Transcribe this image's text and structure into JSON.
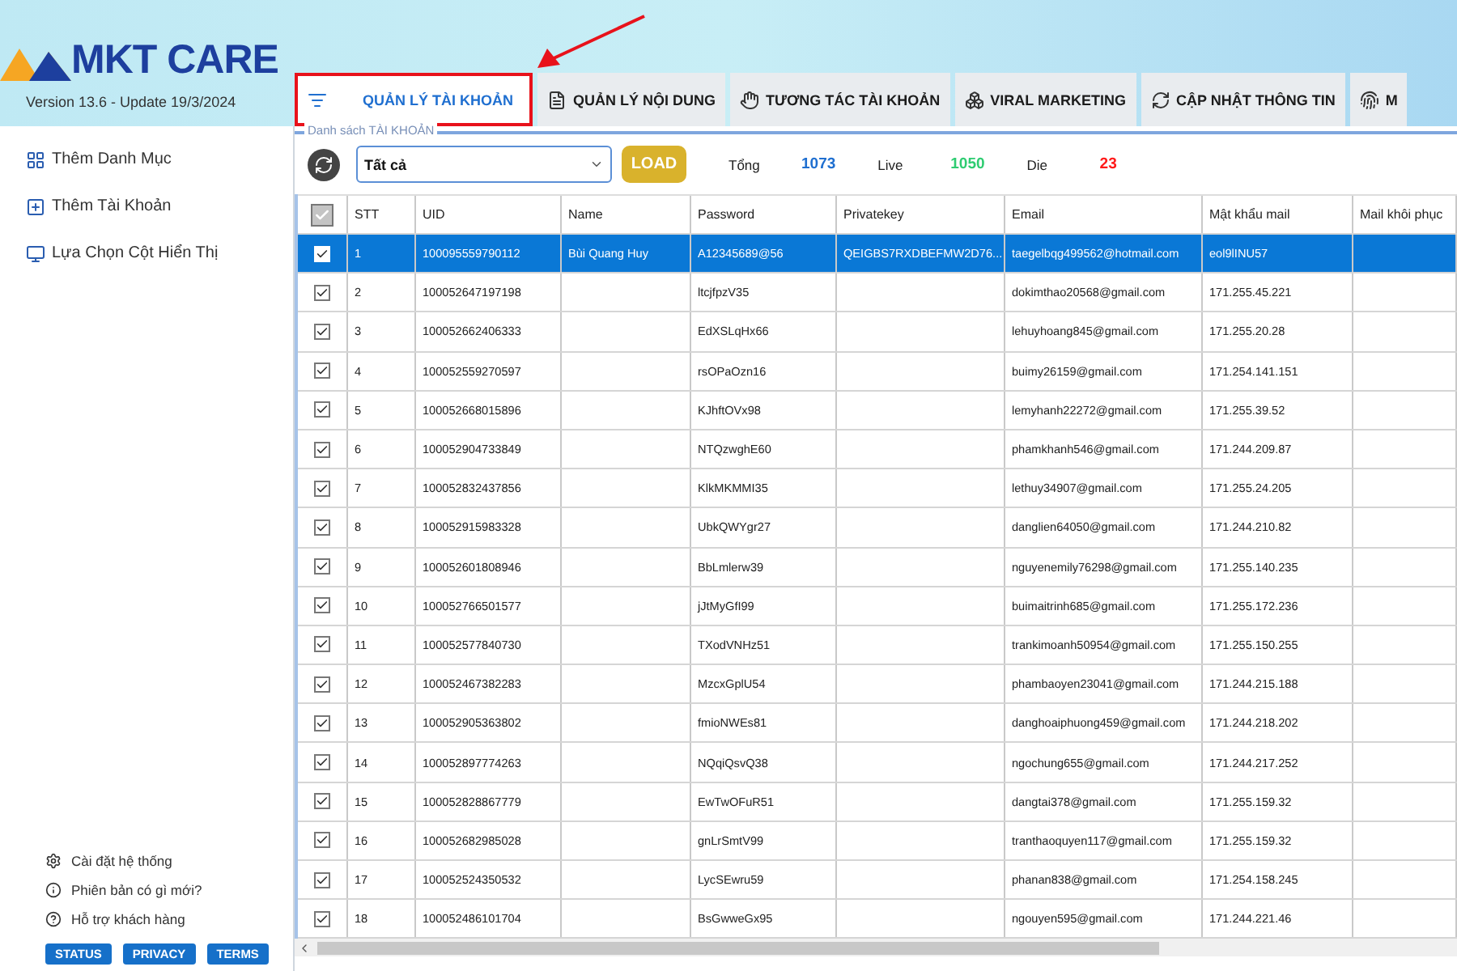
{
  "app": {
    "logo": "MKT CARE",
    "version": "Version  13.6 - Update  19/3/2024"
  },
  "tabs": [
    {
      "label": "QUẢN LÝ TÀI KHOẢN",
      "selected": true,
      "kind": "accounts"
    },
    {
      "label": "QUẢN LÝ NỘI DUNG",
      "selected": false,
      "kind": "content"
    },
    {
      "label": "TƯƠNG TÁC TÀI KHOẢN",
      "selected": false,
      "kind": "interact"
    },
    {
      "label": "VIRAL MARKETING",
      "selected": false,
      "kind": "viral"
    },
    {
      "label": "CẬP NHẬT THÔNG TIN",
      "selected": false,
      "kind": "update"
    },
    {
      "label": "M",
      "selected": false,
      "kind": "fingerprint"
    }
  ],
  "sidebar": {
    "items": [
      {
        "label": "Thêm Danh Mục",
        "kind": "category"
      },
      {
        "label": "Thêm Tài Khoản",
        "kind": "account"
      },
      {
        "label": "Lựa Chọn Cột Hiển Thị",
        "kind": "columns"
      }
    ],
    "footer_items": [
      {
        "label": "Cài đặt hệ thống",
        "kind": "settings"
      },
      {
        "label": "Phiên bản có gì mới?",
        "kind": "info"
      },
      {
        "label": "Hỗ trợ khách hàng",
        "kind": "help"
      }
    ],
    "buttons": [
      "STATUS",
      "PRIVACY",
      "TERMS"
    ]
  },
  "panel": {
    "title": "Danh sách TÀI KHOẢN",
    "filter": "Tất cả",
    "load_button": "LOAD",
    "stats": [
      {
        "label": "Tổng",
        "value": "1073",
        "color": "#1f6fd0"
      },
      {
        "label": "Live",
        "value": "1050",
        "color": "#2ecc71"
      },
      {
        "label": "Die",
        "value": "23",
        "color": "#ff1a1a"
      }
    ]
  },
  "table": {
    "all_checked": true,
    "columns": [
      "STT",
      "UID",
      "Name",
      "Password",
      "Privatekey",
      "Email",
      "Mật khẩu mail",
      "Mail khôi phục"
    ],
    "rows": [
      {
        "checked": true,
        "selected": true,
        "cells": [
          "1",
          "100095559790112",
          "Bùi Quang Huy",
          "A12345689@56",
          "QEIGBS7RXDBEFMW2D76...",
          "taegelbqg499562@hotmail.com",
          "eol9lINU57",
          ""
        ]
      },
      {
        "checked": true,
        "selected": false,
        "cells": [
          "2",
          "100052647197198",
          "",
          "ltcjfpzV35",
          "",
          "dokimthao20568@gmail.com",
          "171.255.45.221",
          ""
        ]
      },
      {
        "checked": true,
        "selected": false,
        "cells": [
          "3",
          "100052662406333",
          "",
          "EdXSLqHx66",
          "",
          "lehuyhoang845@gmail.com",
          "171.255.20.28",
          ""
        ]
      },
      {
        "checked": true,
        "selected": false,
        "cells": [
          "4",
          "100052559270597",
          "",
          "rsOPaOzn16",
          "",
          "buimy26159@gmail.com",
          "171.254.141.151",
          ""
        ]
      },
      {
        "checked": true,
        "selected": false,
        "cells": [
          "5",
          "100052668015896",
          "",
          "KJhftOVx98",
          "",
          "lemyhanh22272@gmail.com",
          "171.255.39.52",
          ""
        ]
      },
      {
        "checked": true,
        "selected": false,
        "cells": [
          "6",
          "100052904733849",
          "",
          "NTQzwghE60",
          "",
          "phamkhanh546@gmail.com",
          "171.244.209.87",
          ""
        ]
      },
      {
        "checked": true,
        "selected": false,
        "cells": [
          "7",
          "100052832437856",
          "",
          "KlkMKMMI35",
          "",
          "lethuy34907@gmail.com",
          "171.255.24.205",
          ""
        ]
      },
      {
        "checked": true,
        "selected": false,
        "cells": [
          "8",
          "100052915983328",
          "",
          "UbkQWYgr27",
          "",
          "danglien64050@gmail.com",
          "171.244.210.82",
          ""
        ]
      },
      {
        "checked": true,
        "selected": false,
        "cells": [
          "9",
          "100052601808946",
          "",
          "BbLmlerw39",
          "",
          "nguyenemily76298@gmail.com",
          "171.255.140.235",
          ""
        ]
      },
      {
        "checked": true,
        "selected": false,
        "cells": [
          "10",
          "100052766501577",
          "",
          "jJtMyGfI99",
          "",
          "buimaitrinh685@gmail.com",
          "171.255.172.236",
          ""
        ]
      },
      {
        "checked": true,
        "selected": false,
        "cells": [
          "11",
          "100052577840730",
          "",
          "TXodVNHz51",
          "",
          "trankimoanh50954@gmail.com",
          "171.255.150.255",
          ""
        ]
      },
      {
        "checked": true,
        "selected": false,
        "cells": [
          "12",
          "100052467382283",
          "",
          "MzcxGplU54",
          "",
          "phambaoyen23041@gmail.com",
          "171.244.215.188",
          ""
        ]
      },
      {
        "checked": true,
        "selected": false,
        "cells": [
          "13",
          "100052905363802",
          "",
          "fmioNWEs81",
          "",
          "danghoaiphuong459@gmail.com",
          "171.244.218.202",
          ""
        ]
      },
      {
        "checked": true,
        "selected": false,
        "cells": [
          "14",
          "100052897774263",
          "",
          "NQqiQsvQ38",
          "",
          "ngochung655@gmail.com",
          "171.244.217.252",
          ""
        ]
      },
      {
        "checked": true,
        "selected": false,
        "cells": [
          "15",
          "100052828867779",
          "",
          "EwTwOFuR51",
          "",
          "dangtai378@gmail.com",
          "171.255.159.32",
          ""
        ]
      },
      {
        "checked": true,
        "selected": false,
        "cells": [
          "16",
          "100052682985028",
          "",
          "gnLrSmtV99",
          "",
          "tranthaoquyen117@gmail.com",
          "171.255.159.32",
          ""
        ]
      },
      {
        "checked": true,
        "selected": false,
        "cells": [
          "17",
          "100052524350532",
          "",
          "LycSEwru59",
          "",
          "phanan838@gmail.com",
          "171.254.158.245",
          ""
        ]
      },
      {
        "checked": true,
        "selected": false,
        "cells": [
          "18",
          "100052486101704",
          "",
          "BsGwweGx95",
          "",
          "ngouyen595@gmail.com",
          "171.244.221.46",
          ""
        ]
      }
    ]
  }
}
